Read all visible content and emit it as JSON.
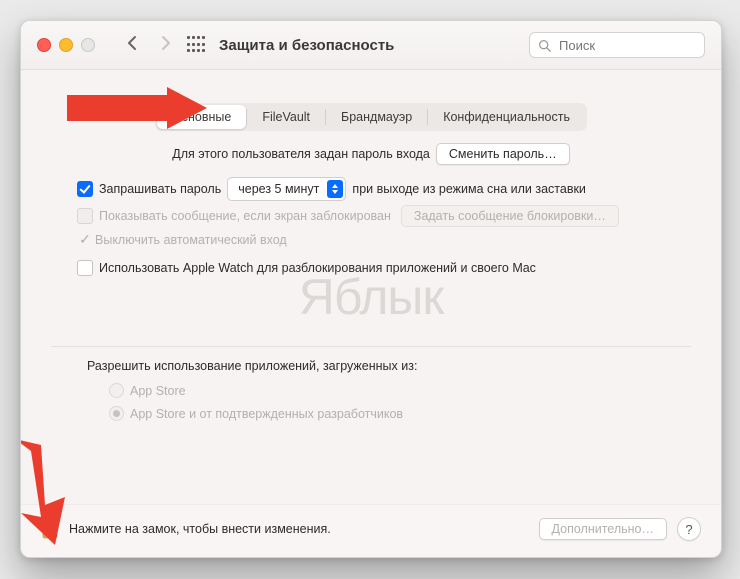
{
  "window": {
    "title": "Защита и безопасность"
  },
  "search": {
    "placeholder": "Поиск"
  },
  "tabs": [
    {
      "label": "Основные"
    },
    {
      "label": "FileVault"
    },
    {
      "label": "Брандмауэр"
    },
    {
      "label": "Конфиденциальность"
    }
  ],
  "main": {
    "login_password_set": "Для этого пользователя задан пароль входа",
    "change_password_btn": "Сменить пароль…",
    "require_password_label": "Запрашивать пароль",
    "require_password_delay": "через 5 минут",
    "require_password_after": "при выходе из режима сна или заставки",
    "show_message_label": "Показывать сообщение, если экран заблокирован",
    "set_lock_message_btn": "Задать сообщение блокировки…",
    "disable_autologin_label": "Выключить автоматический вход",
    "apple_watch_label": "Использовать Apple Watch для разблокирования приложений и своего Mac"
  },
  "allow": {
    "heading": "Разрешить использование приложений, загруженных из:",
    "options": [
      "App Store",
      "App Store и от подтвержденных разработчиков"
    ]
  },
  "footer": {
    "lock_text": "Нажмите на замок, чтобы внести изменения.",
    "advanced_btn": "Дополнительно…",
    "help": "?"
  },
  "watermark": "Яблык"
}
